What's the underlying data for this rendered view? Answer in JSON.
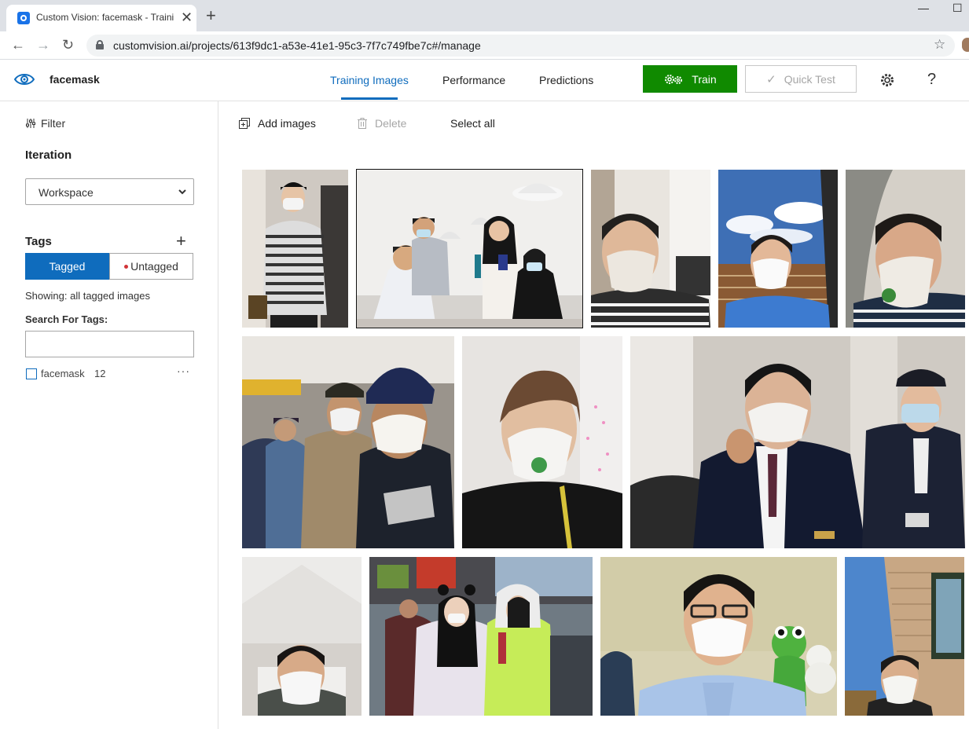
{
  "browser": {
    "tab_title": "Custom Vision: facemask - Traini",
    "tab_close": "✕",
    "new_tab": "+",
    "url": "customvision.ai/projects/613f9dc1-a53e-41e1-95c3-7f7c749fbe7c#/manage",
    "minimize": "—",
    "maximize": "☐"
  },
  "app": {
    "project_name": "facemask",
    "tabs": [
      "Training Images",
      "Performance",
      "Predictions"
    ],
    "train_label": "Train",
    "quick_test_label": "Quick Test",
    "help_label": "?"
  },
  "sidebar": {
    "filter_label": "Filter",
    "iteration_title": "Iteration",
    "iteration_value": "Workspace",
    "tags_title": "Tags",
    "tagged_label": "Tagged",
    "untagged_label": "Untagged",
    "showing_text": "Showing: all tagged images",
    "search_label": "Search For Tags:",
    "search_value": "",
    "tags": [
      {
        "name": "facemask",
        "count": "12"
      }
    ],
    "more_label": "···"
  },
  "commands": {
    "add_images": "Add images",
    "delete": "Delete",
    "select_all": "Select all"
  },
  "colors": {
    "accent": "#0f6cbd",
    "train_green": "#108a00",
    "untagged_dot": "#d13438"
  }
}
